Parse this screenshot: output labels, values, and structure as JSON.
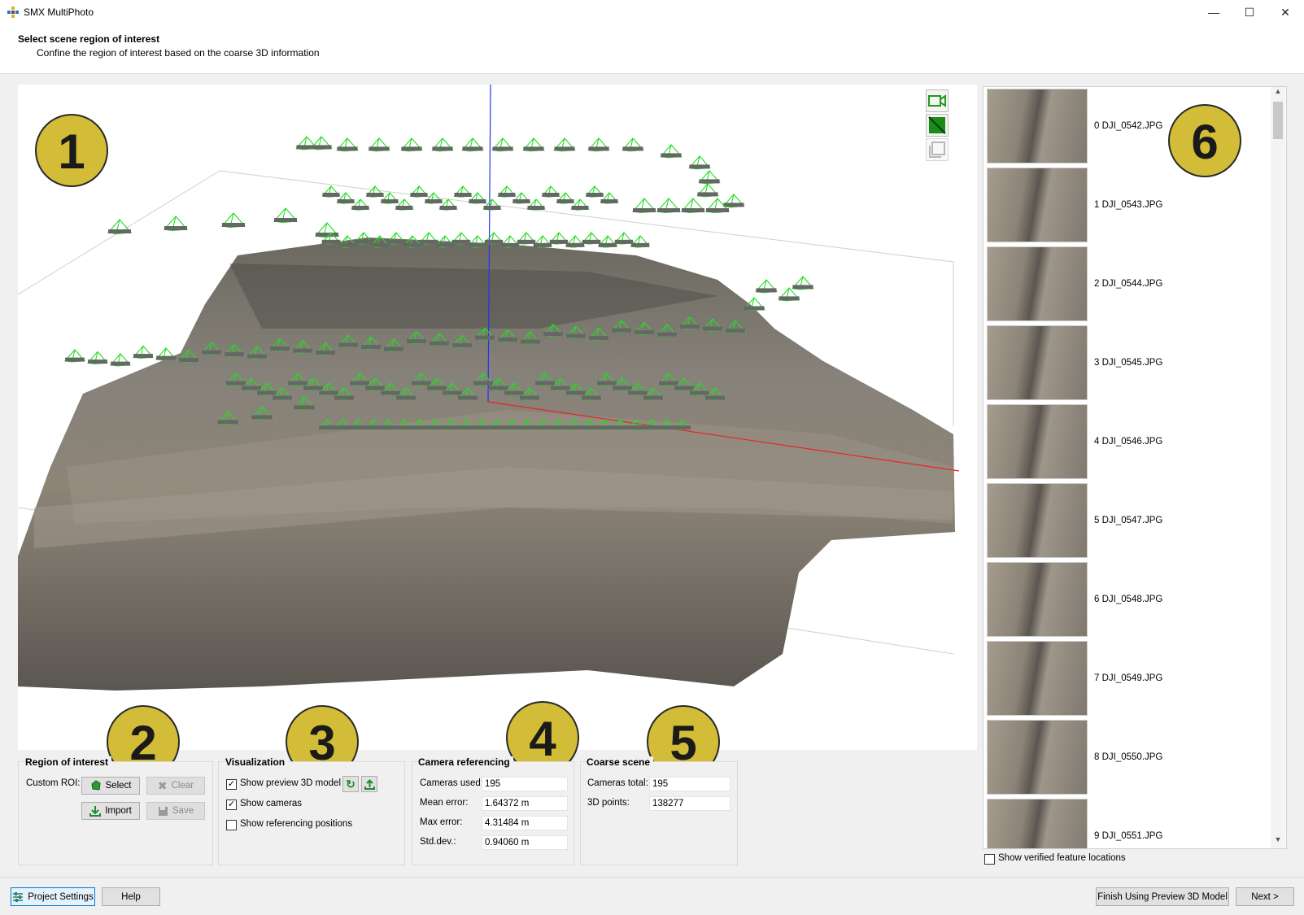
{
  "window": {
    "title": "SMX MultiPhoto",
    "minimize": "—",
    "maximize": "☐",
    "close": "✕"
  },
  "header": {
    "title": "Select scene region of interest",
    "description": "Confine the region of interest based on the coarse 3D information"
  },
  "badges": [
    "1",
    "2",
    "3",
    "4",
    "5",
    "6"
  ],
  "viewport": {
    "tools": [
      "camera-view-icon",
      "model-view-icon",
      "roi-box-icon"
    ]
  },
  "roi": {
    "title": "Region of interest",
    "custom_label": "Custom ROI:",
    "select": "Select",
    "clear": "Clear",
    "import": "Import",
    "save": "Save"
  },
  "visualization": {
    "title": "Visualization",
    "show_preview": "Show preview 3D model",
    "show_preview_checked": true,
    "show_cameras": "Show cameras",
    "show_cameras_checked": true,
    "show_referencing": "Show referencing positions",
    "show_referencing_checked": false
  },
  "camera_ref": {
    "title": "Camera referencing",
    "rows": [
      {
        "label": "Cameras used:",
        "value": "195"
      },
      {
        "label": "Mean error:",
        "value": "1.64372 m"
      },
      {
        "label": "Max error:",
        "value": "4.31484 m"
      },
      {
        "label": "Std.dev.:",
        "value": "0.94060 m"
      }
    ]
  },
  "coarse_scene": {
    "title": "Coarse scene",
    "rows": [
      {
        "label": "Cameras total:",
        "value": "195"
      },
      {
        "label": "3D points:",
        "value": "138277"
      }
    ]
  },
  "images": [
    "0 DJI_0542.JPG",
    "1 DJI_0543.JPG",
    "2 DJI_0544.JPG",
    "3 DJI_0545.JPG",
    "4 DJI_0546.JPG",
    "5 DJI_0547.JPG",
    "6 DJI_0548.JPG",
    "7 DJI_0549.JPG",
    "8 DJI_0550.JPG",
    "9 DJI_0551.JPG"
  ],
  "show_verified": {
    "label": "Show verified feature locations",
    "checked": false
  },
  "footer": {
    "project_settings": "Project Settings",
    "help": "Help",
    "finish": "Finish Using Preview 3D Model",
    "next": "Next >"
  }
}
